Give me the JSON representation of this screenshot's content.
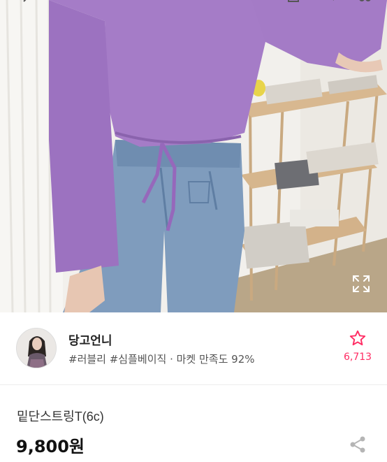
{
  "photo": {
    "expand_icon": "expand-icon",
    "top_icons": [
      "back-icon",
      "home-icon",
      "search-icon",
      "cart-icon"
    ]
  },
  "seller": {
    "name": "당고언니",
    "tags": "#러블리 #심플베이직 · 마켓 만족도 92%",
    "like_count": "6,713",
    "like_icon": "star-icon",
    "accent_color": "#ff2d64"
  },
  "product": {
    "name": "밑단스트링T(6c)",
    "price": "9,800원",
    "share_icon": "share-icon"
  }
}
